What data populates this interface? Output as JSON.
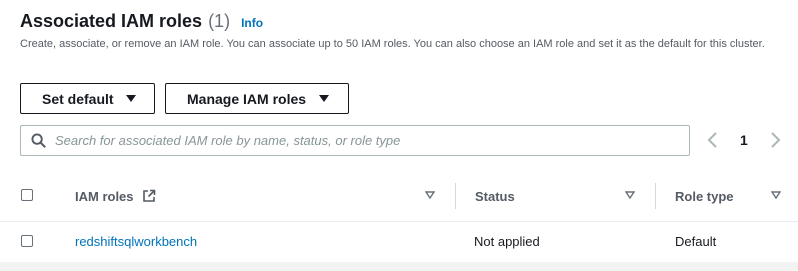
{
  "section": {
    "title": "Associated IAM roles",
    "count": "(1)",
    "info_link": "Info",
    "description": "Create, associate, or remove an IAM role. You can associate up to 50 IAM roles. You can also choose an IAM role and set it as the default for this cluster."
  },
  "actions": {
    "set_default": "Set default",
    "manage_iam_roles": "Manage IAM roles"
  },
  "search": {
    "placeholder": "Search for associated IAM role by name, status, or role type",
    "value": ""
  },
  "pagination": {
    "current_page": "1"
  },
  "table": {
    "columns": [
      "IAM roles",
      "Status",
      "Role type"
    ],
    "rows": [
      {
        "iam_role": "redshiftsqlworkbench",
        "status": "Not applied",
        "role_type": "Default"
      }
    ]
  },
  "icons": {
    "search": "search-icon",
    "external": "external-link-icon",
    "sort": "sort-caret-icon",
    "prev": "chevron-left-icon",
    "next": "chevron-right-icon"
  },
  "colors": {
    "link": "#0073bb",
    "text": "#16191f",
    "muted": "#545b64",
    "border": "#aab7b8"
  }
}
